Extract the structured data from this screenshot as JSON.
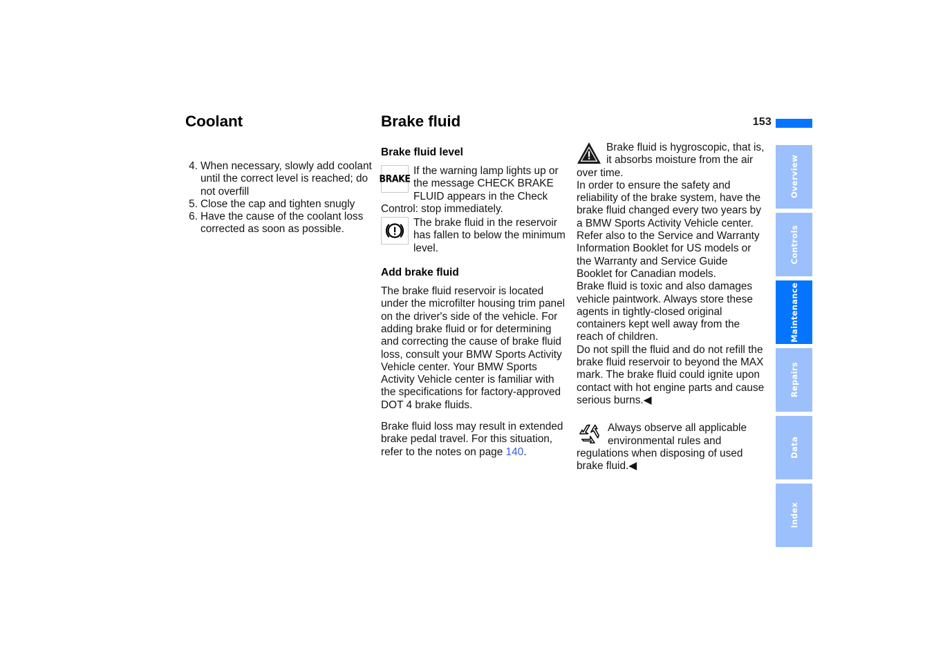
{
  "page": {
    "number": "153",
    "accent_color": "#0575fd",
    "tab_inactive_color": "#9cc0fb",
    "link_color": "#3b5bdb"
  },
  "column_left": {
    "title": "Coolant",
    "list": [
      {
        "num": "4.",
        "text": "When necessary, slowly add coolant until the correct level is reached; do not overfill"
      },
      {
        "num": "5.",
        "text": "Close the cap and tighten snugly"
      },
      {
        "num": "6.",
        "text": "Have the cause of the coolant loss corrected as soon as possible."
      }
    ]
  },
  "column_middle": {
    "title": "Brake fluid",
    "subtitle_level": "Brake fluid level",
    "brake_lamp_icon_text": "BRAKE",
    "lamp_para": "If the warning lamp lights up or the message CHECK BRAKE FLUID appears in the Check Control: stop immediately.",
    "reservoir_para": "The brake fluid in the reservoir has fallen to below the minimum level.",
    "subtitle_add": "Add brake fluid",
    "add_para_1": "The brake fluid reservoir is located under the microfilter housing trim panel on the driver's side of the vehicle. For adding brake fluid or for determining and correcting the cause of brake fluid loss, consult your BMW Sports Activity Vehicle center. Your BMW Sports Activity Vehicle center is familiar with the specifications for factory-approved DOT 4 brake fluids.",
    "add_para_2_before": "Brake fluid loss may result in extended brake pedal travel. For this situation, refer to the notes on page ",
    "add_para_2_link": "140",
    "add_para_2_after": "."
  },
  "column_right": {
    "warning_para_1": "Brake fluid is hygroscopic, that is, it absorbs moisture from the air over time.",
    "warning_para_2": "In order to ensure the safety and reliability of the brake system, have the brake fluid changed every two years by a BMW Sports Activity Vehicle center. Refer also to the Service and Warranty Information Booklet for US models or the Warranty and Service Guide Booklet for Canadian models.",
    "warning_para_3": "Brake fluid is toxic and also damages vehicle paintwork. Always store these agents in tightly-closed original containers kept well away from the reach of children.",
    "warning_para_4": "Do not spill the fluid and do not refill the brake fluid reservoir to beyond the MAX mark. The brake fluid could ignite upon contact with hot engine parts and cause serious burns.◀",
    "recycle_para": "Always observe all applicable environmental rules and regulations when disposing of used brake fluid.◀"
  },
  "tabs": [
    {
      "label": "Overview",
      "active": false
    },
    {
      "label": "Controls",
      "active": false
    },
    {
      "label": "Maintenance",
      "active": true
    },
    {
      "label": "Repairs",
      "active": false
    },
    {
      "label": "Data",
      "active": false
    },
    {
      "label": "Index",
      "active": false
    }
  ]
}
